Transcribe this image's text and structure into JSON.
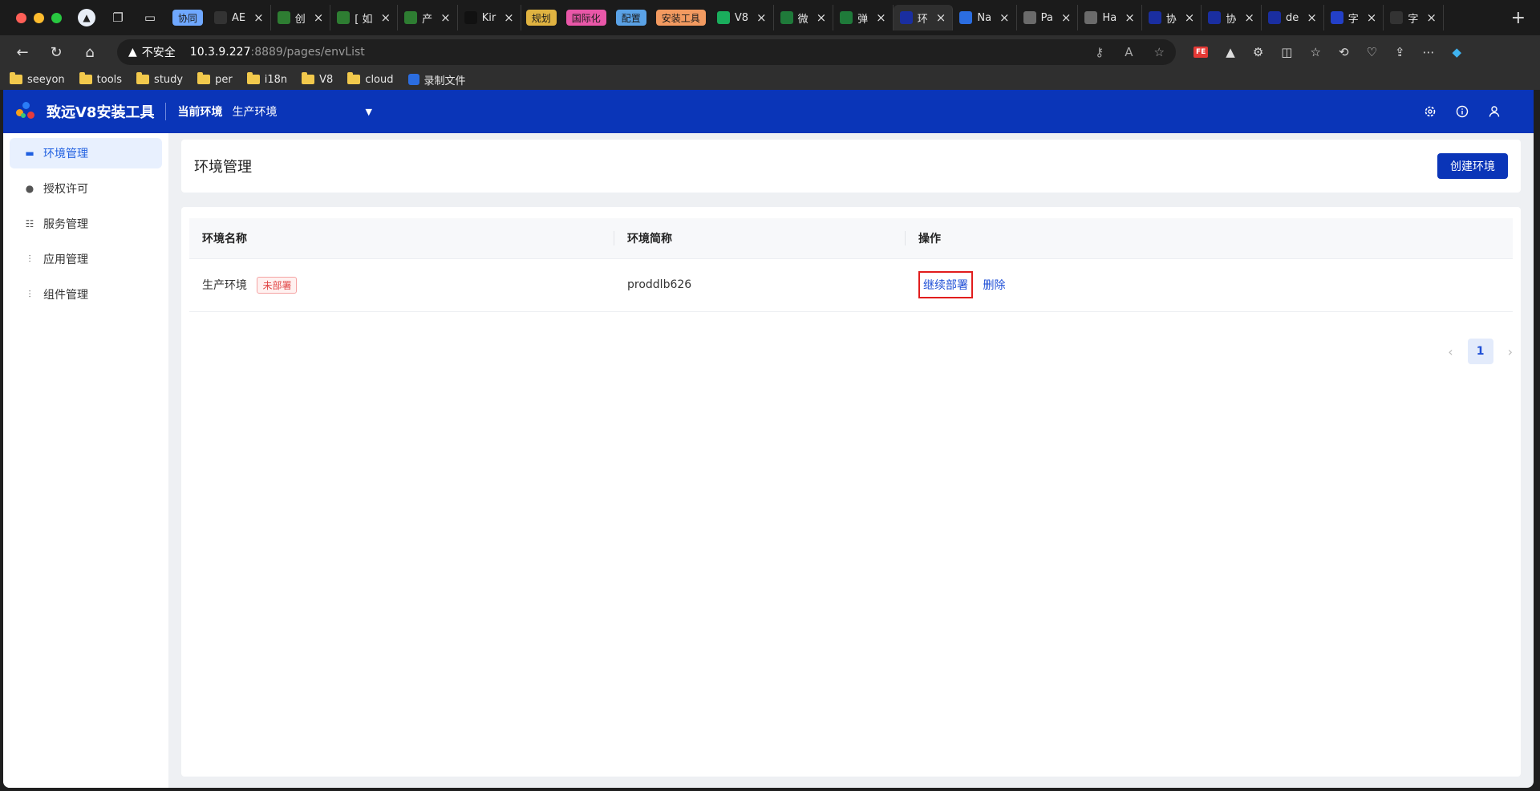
{
  "browser": {
    "tabs": [
      {
        "label": "协同",
        "type": "group",
        "color": "#6fa8ff"
      },
      {
        "label": "AE",
        "fav": "ae",
        "favcolor": "#333"
      },
      {
        "label": "创",
        "fav": "leaf",
        "favcolor": "#2e7d32"
      },
      {
        "label": "[ 如",
        "fav": "leaf",
        "favcolor": "#2e7d32"
      },
      {
        "label": "产",
        "fav": "leaf",
        "favcolor": "#2e7d32"
      },
      {
        "label": "Kir",
        "fav": "K",
        "favcolor": "#111"
      },
      {
        "label": "规划",
        "type": "group",
        "color": "#e0b341"
      },
      {
        "label": "国际化",
        "type": "group",
        "color": "#e957a8"
      },
      {
        "label": "配置",
        "type": "group",
        "color": "#5aa2e6"
      },
      {
        "label": "安装工具",
        "type": "group",
        "color": "#f29a60"
      },
      {
        "label": "V8",
        "fav": "v",
        "favcolor": "#1aad5c"
      },
      {
        "label": "微",
        "fav": "x",
        "favcolor": "#1f7a3a"
      },
      {
        "label": "弹",
        "fav": "x",
        "favcolor": "#1f7a3a"
      },
      {
        "label": "环",
        "fav": "s",
        "favcolor": "#1a2ea0",
        "active": true
      },
      {
        "label": "Na",
        "fav": "∞",
        "favcolor": "#2b6de0"
      },
      {
        "label": "Pa",
        "fav": "p",
        "favcolor": "#6b6b6b"
      },
      {
        "label": "Ha",
        "fav": "h",
        "favcolor": "#6b6b6b"
      },
      {
        "label": "协",
        "fav": "s",
        "favcolor": "#1a2ea0"
      },
      {
        "label": "协",
        "fav": "s",
        "favcolor": "#1a2ea0"
      },
      {
        "label": "de",
        "fav": "s",
        "favcolor": "#1a2ea0"
      },
      {
        "label": "字",
        "fav": "p",
        "favcolor": "#2340c8"
      },
      {
        "label": "字",
        "fav": "c",
        "favcolor": "#333"
      }
    ],
    "url": {
      "insecure_label": "不安全",
      "host": "10.3.9.227",
      "path": ":8889/pages/envList"
    },
    "bookmarks": [
      "seeyon",
      "tools",
      "study",
      "per",
      "i18n",
      "V8",
      "cloud",
      "录制文件"
    ]
  },
  "header": {
    "app_title": "致远V8安装工具",
    "env_label": "当前环境",
    "env_value": "生产环境"
  },
  "sidebar": {
    "items": [
      {
        "label": "环境管理",
        "icon": "env-icon",
        "active": true
      },
      {
        "label": "授权许可",
        "icon": "key-icon"
      },
      {
        "label": "服务管理",
        "icon": "service-icon"
      },
      {
        "label": "应用管理",
        "icon": "app-icon"
      },
      {
        "label": "组件管理",
        "icon": "component-icon"
      }
    ]
  },
  "main": {
    "title": "环境管理",
    "create_button": "创建环境",
    "table": {
      "columns": [
        "环境名称",
        "环境简称",
        "操作"
      ],
      "rows": [
        {
          "name": "生产环境",
          "status": "未部署",
          "short": "proddlb626",
          "actions": [
            "继续部署",
            "删除"
          ]
        }
      ]
    },
    "pagination": {
      "current": "1"
    }
  }
}
